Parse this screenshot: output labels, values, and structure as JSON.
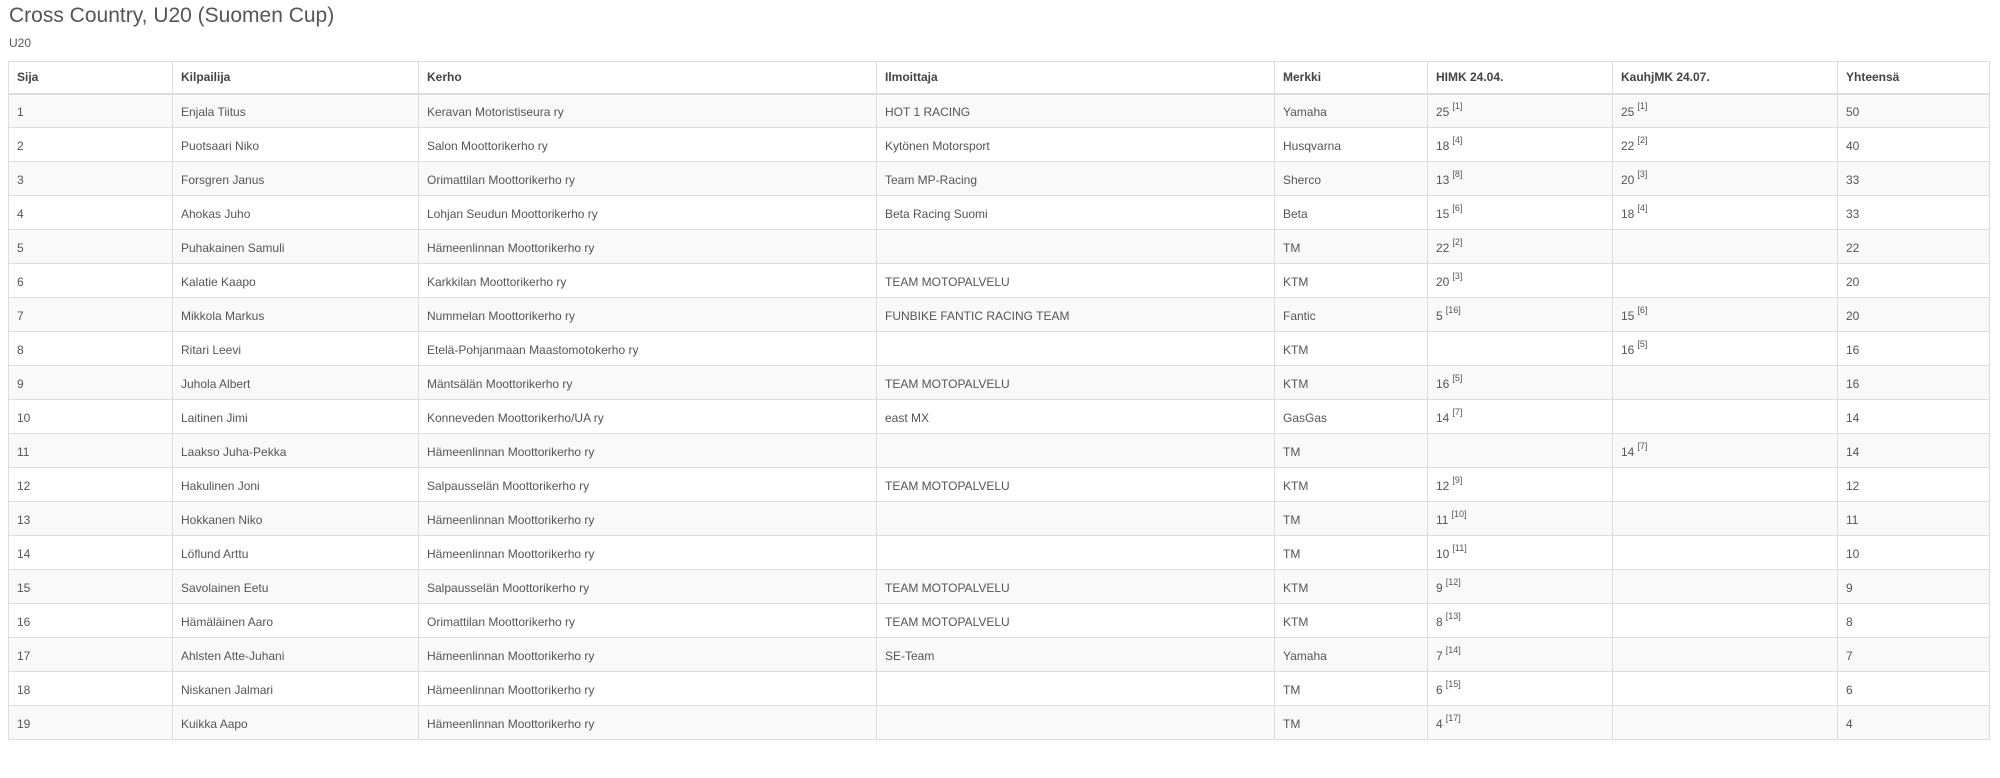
{
  "page": {
    "title": "Cross Country, U20 (Suomen Cup)",
    "subtitle": "U20"
  },
  "table": {
    "headers": [
      "Sija",
      "Kilpailija",
      "Kerho",
      "Ilmoittaja",
      "Merkki",
      "HIMK 24.04.",
      "KauhjMK 24.07.",
      "Yhteensä"
    ],
    "rows": [
      {
        "sija": "1",
        "kilpailija": "Enjala Tiitus",
        "kerho": "Keravan Motoristiseura ry",
        "ilmoittaja": "HOT 1 RACING",
        "merkki": "Yamaha",
        "himk": {
          "points": "25",
          "ref": "[1]"
        },
        "kauhjmk": {
          "points": "25",
          "ref": "[1]"
        },
        "yhteensa": "50"
      },
      {
        "sija": "2",
        "kilpailija": "Puotsaari Niko",
        "kerho": "Salon Moottorikerho ry",
        "ilmoittaja": "Kytönen Motorsport",
        "merkki": "Husqvarna",
        "himk": {
          "points": "18",
          "ref": "[4]"
        },
        "kauhjmk": {
          "points": "22",
          "ref": "[2]"
        },
        "yhteensa": "40"
      },
      {
        "sija": "3",
        "kilpailija": "Forsgren Janus",
        "kerho": "Orimattilan Moottorikerho ry",
        "ilmoittaja": "Team MP-Racing",
        "merkki": "Sherco",
        "himk": {
          "points": "13",
          "ref": "[8]"
        },
        "kauhjmk": {
          "points": "20",
          "ref": "[3]"
        },
        "yhteensa": "33"
      },
      {
        "sija": "4",
        "kilpailija": "Ahokas Juho",
        "kerho": "Lohjan Seudun Moottorikerho ry",
        "ilmoittaja": "Beta Racing Suomi",
        "merkki": "Beta",
        "himk": {
          "points": "15",
          "ref": "[6]"
        },
        "kauhjmk": {
          "points": "18",
          "ref": "[4]"
        },
        "yhteensa": "33"
      },
      {
        "sija": "5",
        "kilpailija": "Puhakainen Samuli",
        "kerho": "Hämeenlinnan Moottorikerho ry",
        "ilmoittaja": "",
        "merkki": "TM",
        "himk": {
          "points": "22",
          "ref": "[2]"
        },
        "kauhjmk": {
          "points": "",
          "ref": ""
        },
        "yhteensa": "22"
      },
      {
        "sija": "6",
        "kilpailija": "Kalatie Kaapo",
        "kerho": "Karkkilan Moottorikerho ry",
        "ilmoittaja": "TEAM MOTOPALVELU",
        "merkki": "KTM",
        "himk": {
          "points": "20",
          "ref": "[3]"
        },
        "kauhjmk": {
          "points": "",
          "ref": ""
        },
        "yhteensa": "20"
      },
      {
        "sija": "7",
        "kilpailija": "Mikkola Markus",
        "kerho": "Nummelan Moottorikerho ry",
        "ilmoittaja": "FUNBIKE FANTIC RACING TEAM",
        "merkki": "Fantic",
        "himk": {
          "points": "5",
          "ref": "[16]"
        },
        "kauhjmk": {
          "points": "15",
          "ref": "[6]"
        },
        "yhteensa": "20"
      },
      {
        "sija": "8",
        "kilpailija": "Ritari Leevi",
        "kerho": "Etelä-Pohjanmaan Maastomotokerho ry",
        "ilmoittaja": "",
        "merkki": "KTM",
        "himk": {
          "points": "",
          "ref": ""
        },
        "kauhjmk": {
          "points": "16",
          "ref": "[5]"
        },
        "yhteensa": "16"
      },
      {
        "sija": "9",
        "kilpailija": "Juhola Albert",
        "kerho": "Mäntsälän Moottorikerho ry",
        "ilmoittaja": "TEAM MOTOPALVELU",
        "merkki": "KTM",
        "himk": {
          "points": "16",
          "ref": "[5]"
        },
        "kauhjmk": {
          "points": "",
          "ref": ""
        },
        "yhteensa": "16"
      },
      {
        "sija": "10",
        "kilpailija": "Laitinen Jimi",
        "kerho": "Konneveden Moottorikerho/UA ry",
        "ilmoittaja": "east MX",
        "merkki": "GasGas",
        "himk": {
          "points": "14",
          "ref": "[7]"
        },
        "kauhjmk": {
          "points": "",
          "ref": ""
        },
        "yhteensa": "14"
      },
      {
        "sija": "11",
        "kilpailija": "Laakso Juha-Pekka",
        "kerho": "Hämeenlinnan Moottorikerho ry",
        "ilmoittaja": "",
        "merkki": "TM",
        "himk": {
          "points": "",
          "ref": ""
        },
        "kauhjmk": {
          "points": "14",
          "ref": "[7]"
        },
        "yhteensa": "14"
      },
      {
        "sija": "12",
        "kilpailija": "Hakulinen Joni",
        "kerho": "Salpausselän Moottorikerho ry",
        "ilmoittaja": "TEAM MOTOPALVELU",
        "merkki": "KTM",
        "himk": {
          "points": "12",
          "ref": "[9]"
        },
        "kauhjmk": {
          "points": "",
          "ref": ""
        },
        "yhteensa": "12"
      },
      {
        "sija": "13",
        "kilpailija": "Hokkanen Niko",
        "kerho": "Hämeenlinnan Moottorikerho ry",
        "ilmoittaja": "",
        "merkki": "TM",
        "himk": {
          "points": "11",
          "ref": "[10]"
        },
        "kauhjmk": {
          "points": "",
          "ref": ""
        },
        "yhteensa": "11"
      },
      {
        "sija": "14",
        "kilpailija": "Löflund Arttu",
        "kerho": "Hämeenlinnan Moottorikerho ry",
        "ilmoittaja": "",
        "merkki": "TM",
        "himk": {
          "points": "10",
          "ref": "[11]"
        },
        "kauhjmk": {
          "points": "",
          "ref": ""
        },
        "yhteensa": "10"
      },
      {
        "sija": "15",
        "kilpailija": "Savolainen Eetu",
        "kerho": "Salpausselän Moottorikerho ry",
        "ilmoittaja": "TEAM MOTOPALVELU",
        "merkki": "KTM",
        "himk": {
          "points": "9",
          "ref": "[12]"
        },
        "kauhjmk": {
          "points": "",
          "ref": ""
        },
        "yhteensa": "9"
      },
      {
        "sija": "16",
        "kilpailija": "Hämäläinen Aaro",
        "kerho": "Orimattilan Moottorikerho ry",
        "ilmoittaja": "TEAM MOTOPALVELU",
        "merkki": "KTM",
        "himk": {
          "points": "8",
          "ref": "[13]"
        },
        "kauhjmk": {
          "points": "",
          "ref": ""
        },
        "yhteensa": "8"
      },
      {
        "sija": "17",
        "kilpailija": "Ahlsten Atte-Juhani",
        "kerho": "Hämeenlinnan Moottorikerho ry",
        "ilmoittaja": "SE-Team",
        "merkki": "Yamaha",
        "himk": {
          "points": "7",
          "ref": "[14]"
        },
        "kauhjmk": {
          "points": "",
          "ref": ""
        },
        "yhteensa": "7"
      },
      {
        "sija": "18",
        "kilpailija": "Niskanen Jalmari",
        "kerho": "Hämeenlinnan Moottorikerho ry",
        "ilmoittaja": "",
        "merkki": "TM",
        "himk": {
          "points": "6",
          "ref": "[15]"
        },
        "kauhjmk": {
          "points": "",
          "ref": ""
        },
        "yhteensa": "6"
      },
      {
        "sija": "19",
        "kilpailija": "Kuikka Aapo",
        "kerho": "Hämeenlinnan Moottorikerho ry",
        "ilmoittaja": "",
        "merkki": "TM",
        "himk": {
          "points": "4",
          "ref": "[17]"
        },
        "kauhjmk": {
          "points": "",
          "ref": ""
        },
        "yhteensa": "4"
      }
    ]
  }
}
